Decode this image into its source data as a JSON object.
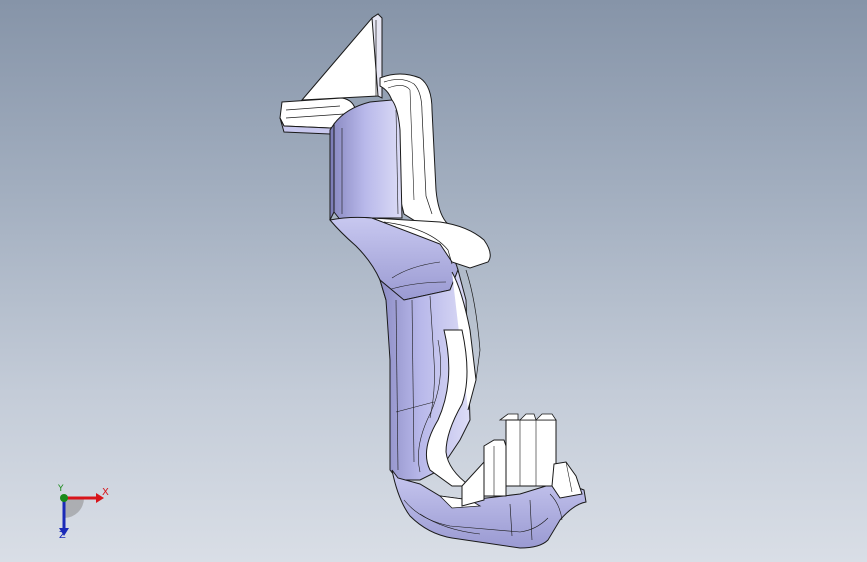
{
  "viewport": {
    "background_top": "#8694a8",
    "background_bottom": "#d9dee6"
  },
  "model": {
    "shade_color": "#b3b3e6",
    "highlight_color": "#ffffff",
    "edge_color": "#1a1a1a"
  },
  "triad": {
    "x_label": "X",
    "y_label": "Y",
    "z_label": "Z",
    "x_color": "#d8141a",
    "y_color": "#1a8a1a",
    "z_color": "#1a2ab8"
  }
}
